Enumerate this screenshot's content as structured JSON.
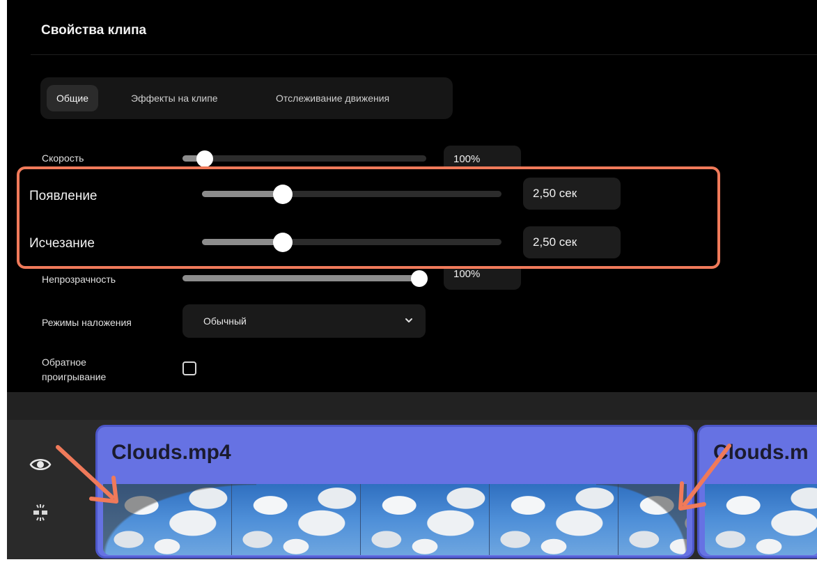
{
  "panel": {
    "title": "Свойства клипа",
    "tabs": [
      {
        "label": "Общие",
        "active": true
      },
      {
        "label": "Эффекты на клипе",
        "active": false
      },
      {
        "label": "Отслеживание движения",
        "active": false
      }
    ]
  },
  "properties": {
    "speed": {
      "label": "Скорость",
      "value": "100%",
      "level": 0.09
    },
    "fade_in": {
      "label": "Появление",
      "value": "2,50 сек",
      "level": 0.27
    },
    "fade_out": {
      "label": "Исчезание",
      "value": "2,50 сек",
      "level": 0.27
    },
    "opacity": {
      "label": "Непрозрачность",
      "value": "100%",
      "level": 1.0
    },
    "blend_mode": {
      "label": "Режимы наложения",
      "value": "Обычный"
    },
    "reverse": {
      "label_line1": "Обратное",
      "label_line2": "проигрывание",
      "checked": false
    }
  },
  "timeline": {
    "clips": [
      {
        "name": "Clouds.mp4"
      },
      {
        "name": "Clouds.m"
      }
    ]
  },
  "colors": {
    "highlight": "#f07a5a",
    "clip": "#6672e3",
    "arrow": "#f07a5a"
  }
}
